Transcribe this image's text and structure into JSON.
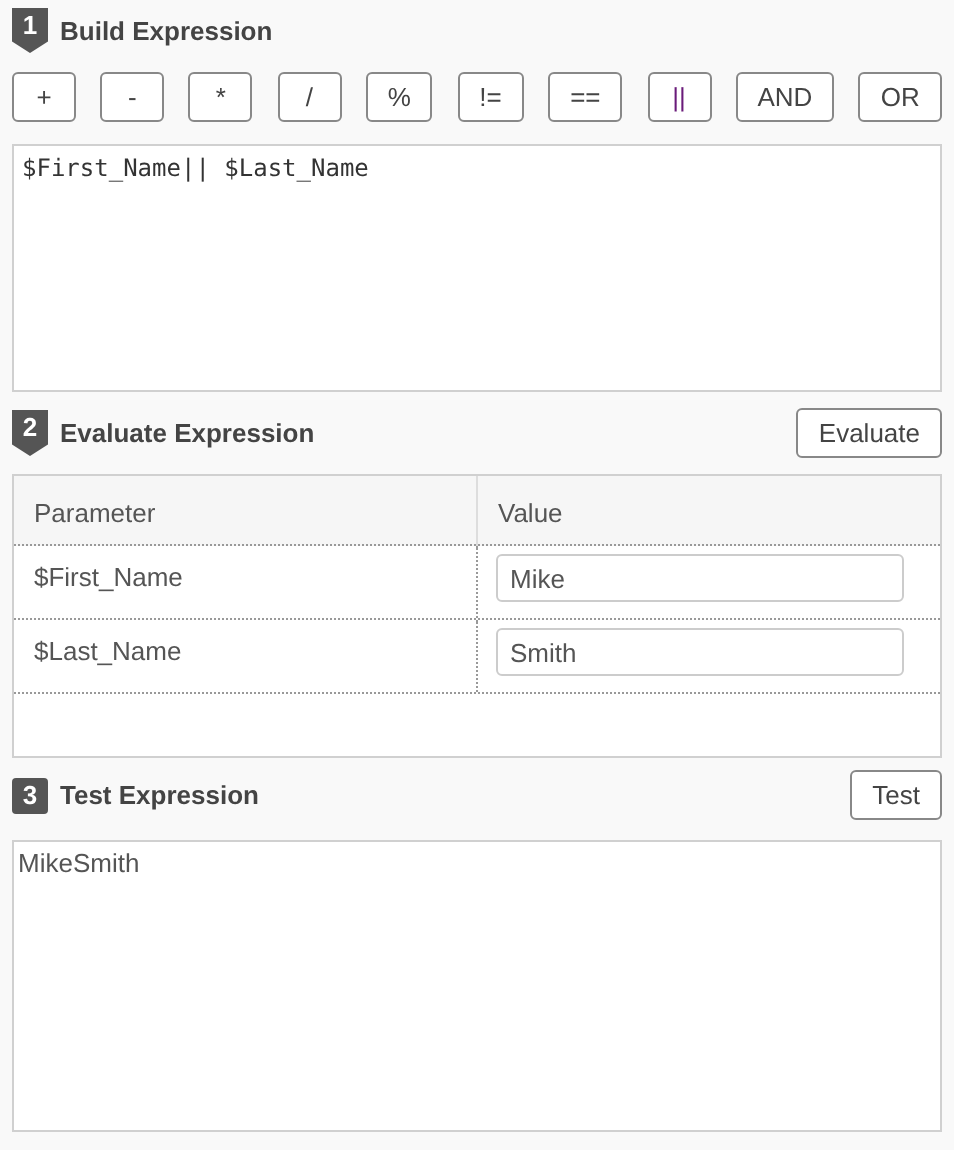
{
  "build": {
    "step": "1",
    "kind": "shield",
    "title": "Build Expression",
    "operators": [
      "+",
      "-",
      "*",
      "/",
      "%",
      "!=",
      "==",
      "||",
      "AND",
      "OR"
    ],
    "expression": "$First_Name|| $Last_Name"
  },
  "evaluate": {
    "step": "2",
    "kind": "shield",
    "title": "Evaluate Expression",
    "button": "Evaluate",
    "table": {
      "columns": [
        "Parameter",
        "Value"
      ],
      "rows": [
        {
          "parameter": "$First_Name",
          "value": "Mike"
        },
        {
          "parameter": "$Last_Name",
          "value": "Smith"
        }
      ]
    }
  },
  "test": {
    "step": "3",
    "kind": "square",
    "title": "Test Expression",
    "button": "Test",
    "result": "MikeSmith"
  }
}
